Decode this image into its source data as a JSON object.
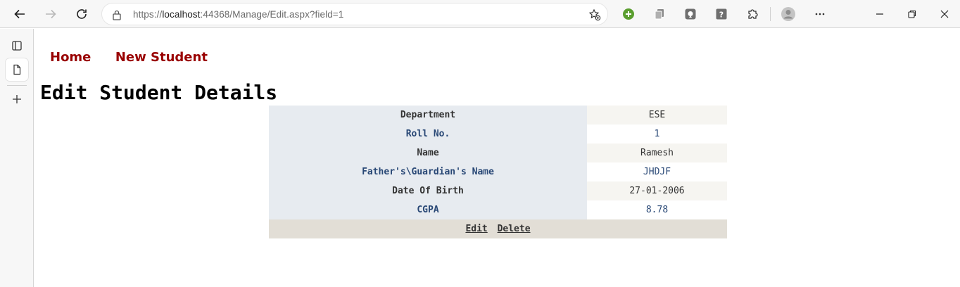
{
  "browser": {
    "url_prefix": "https://",
    "url_host": "localhost",
    "url_rest": ":44368/Manage/Edit.aspx?field=1"
  },
  "nav": {
    "home": "Home",
    "new_student": "New Student"
  },
  "page_title": "Edit Student Details",
  "details": [
    {
      "label": "Department",
      "value": "ESE"
    },
    {
      "label": "Roll No.",
      "value": "1"
    },
    {
      "label": "Name",
      "value": "Ramesh"
    },
    {
      "label": "Father's\\Guardian's Name",
      "value": "JHDJF"
    },
    {
      "label": "Date Of Birth",
      "value": "27-01-2006"
    },
    {
      "label": "CGPA",
      "value": "8.78"
    }
  ],
  "actions": {
    "edit": "Edit",
    "delete": "Delete"
  },
  "colors": {
    "nav_link": "#990000",
    "header_cell_bg": "#e7ebf0",
    "alt_row_bg": "#f6f5f1",
    "alt_text": "#284775",
    "footer_bg": "#e2ded6"
  }
}
